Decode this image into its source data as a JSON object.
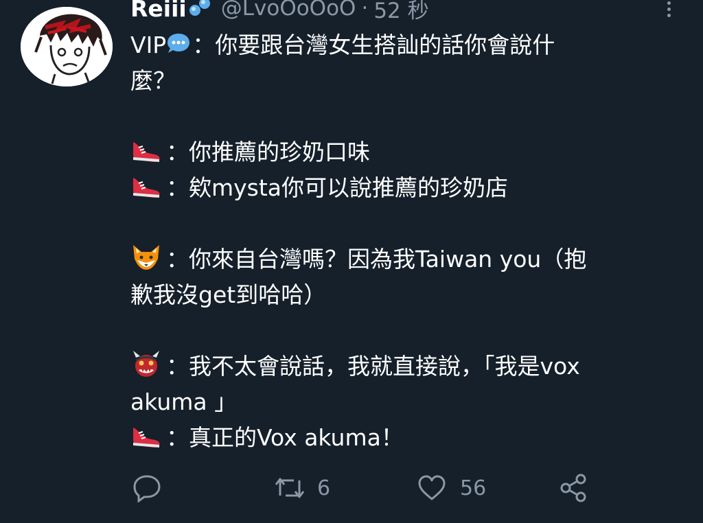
{
  "tweet": {
    "display_name": "Reiii",
    "handle": "@LvoOoOoO",
    "separator": "·",
    "time": "52 秒",
    "lines": [
      {
        "speaker": "VIP",
        "text": "：你要跟台灣女生搭訕的話你會說什"
      },
      {
        "text": "麼？"
      },
      {
        "text": "：你推薦的珍奶口味"
      },
      {
        "text": "：欸mysta你可以說推薦的珍奶店"
      },
      {
        "text": "：你來自台灣嗎？因為我Taiwan you（抱"
      },
      {
        "text": "歉我沒get到哈哈）"
      },
      {
        "text": "：我不太會說話，我就直接說，「我是vox"
      },
      {
        "text": "akuma 」"
      },
      {
        "text": "：真正的Vox akuma！"
      }
    ],
    "emojis": {
      "name_emoji": "sweat-droplets-icon",
      "vip_emoji": "speech-bubble-icon",
      "shoe": "running-shoe-icon",
      "fox": "fox-face-icon",
      "ogre": "ogre-icon"
    }
  },
  "actions": {
    "reply_count": "",
    "retweet_count": "6",
    "like_count": "56"
  },
  "colors": {
    "background": "#15202b",
    "text": "#ffffff",
    "secondary": "#8b98a5"
  }
}
